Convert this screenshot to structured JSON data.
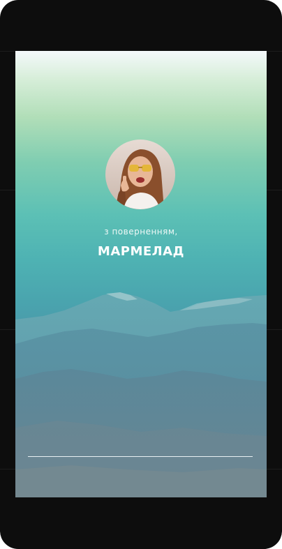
{
  "welcome": {
    "greeting": "з поверненням,",
    "username": "МАРМЕЛАД"
  },
  "icons": {
    "avatar": "profile-photo-avatar"
  },
  "colors": {
    "bezel": "#0d0d0d",
    "gradient_top": "#f4f9fb",
    "gradient_mid": "#5cc0b5",
    "gradient_bottom": "#537e94",
    "text": "#ffffff"
  }
}
